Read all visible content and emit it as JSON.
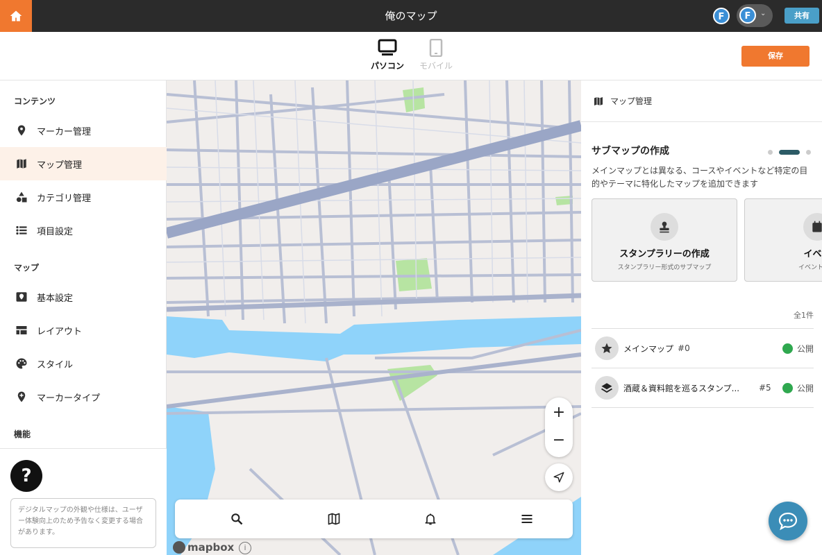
{
  "app": {
    "title": "俺のマップ",
    "avatar_initial": "F",
    "share_label": "共有",
    "save_label": "保存"
  },
  "devices": {
    "pc_label": "パソコン",
    "mobile_label": "モバイル",
    "selected": "パソコン"
  },
  "sidebar": {
    "sections": [
      {
        "label": "コンテンツ"
      },
      {
        "label": "マップ"
      },
      {
        "label": "機能"
      }
    ],
    "items": [
      {
        "label": "マーカー管理",
        "icon": "marker-pin-icon"
      },
      {
        "label": "マップ管理",
        "icon": "map-icon",
        "active": true
      },
      {
        "label": "カテゴリ管理",
        "icon": "shapes-icon"
      },
      {
        "label": "項目設定",
        "icon": "list-icon"
      },
      {
        "label": "基本設定",
        "icon": "map-pin-square-icon"
      },
      {
        "label": "レイアウト",
        "icon": "layout-icon"
      },
      {
        "label": "スタイル",
        "icon": "palette-icon"
      },
      {
        "label": "マーカータイプ",
        "icon": "add-marker-icon"
      }
    ],
    "help_label": "?",
    "notice": "デジタルマップの外観や仕様は、ユーザー体験向上のため予告なく変更する場合があります。"
  },
  "map": {
    "zoom_in": "+",
    "zoom_out": "−",
    "attribution": "mapbox",
    "info": "i"
  },
  "panel": {
    "header": "マップ管理",
    "submap_title": "サブマップの作成",
    "submap_desc": "メインマップとは異なる、コースやイベントなど特定の目的やテーマに特化したマップを追加できます",
    "cards": [
      {
        "title": "スタンプラリーの作成",
        "subtitle": "スタンプラリー形式のサブマップ",
        "icon": "stamp-icon"
      },
      {
        "title": "イベン",
        "subtitle": "イベント形式",
        "icon": "calendar-icon"
      }
    ],
    "count": "全1件",
    "maps": [
      {
        "name": "メインマップ",
        "id": "#0",
        "status": "公開",
        "icon": "star-icon"
      },
      {
        "name": "酒蔵＆資料館を巡るスタンプ...",
        "id": "#5",
        "status": "公開",
        "icon": "layers-icon"
      }
    ]
  },
  "colors": {
    "accent": "#f0782f",
    "topbar": "#2b2b2b",
    "share": "#4a9fc8",
    "public": "#2fa84f",
    "water": "#8fd3fa",
    "park": "#b7e4a2",
    "road": "#b8bfd4"
  }
}
